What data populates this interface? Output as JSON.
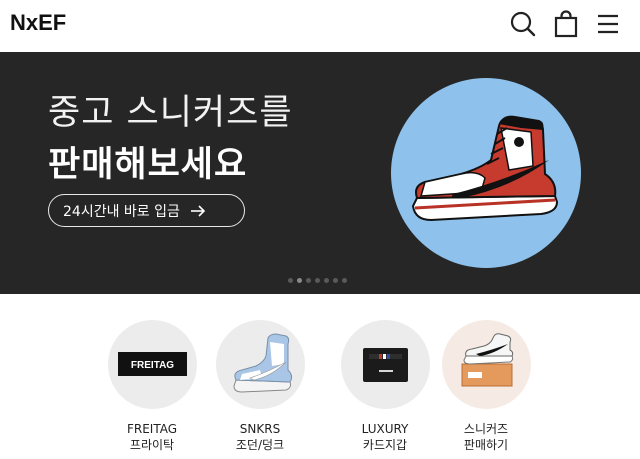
{
  "header": {
    "logo": "NxEF",
    "icons": [
      "search-icon",
      "shopping-bag-icon",
      "menu-icon"
    ]
  },
  "banner": {
    "line1": "중고 스니커즈를",
    "line2": "판매해보세요",
    "cta_label": "24시간내 바로 입금",
    "cta_icon": "arrow-right-icon",
    "background_color": "#262626",
    "circle_color": "#8ec2ec",
    "slide_count": 7,
    "active_slide": 2
  },
  "categories": [
    {
      "icon_text": "FREITAG",
      "line1": "FREITAG",
      "line2": "프라이탁"
    },
    {
      "line1": "SNKRS",
      "line2": "조던/덩크"
    },
    {
      "line1": "LUXURY",
      "line2": "카드지갑"
    },
    {
      "line1": "스니커즈",
      "line2": "판매하기"
    }
  ]
}
